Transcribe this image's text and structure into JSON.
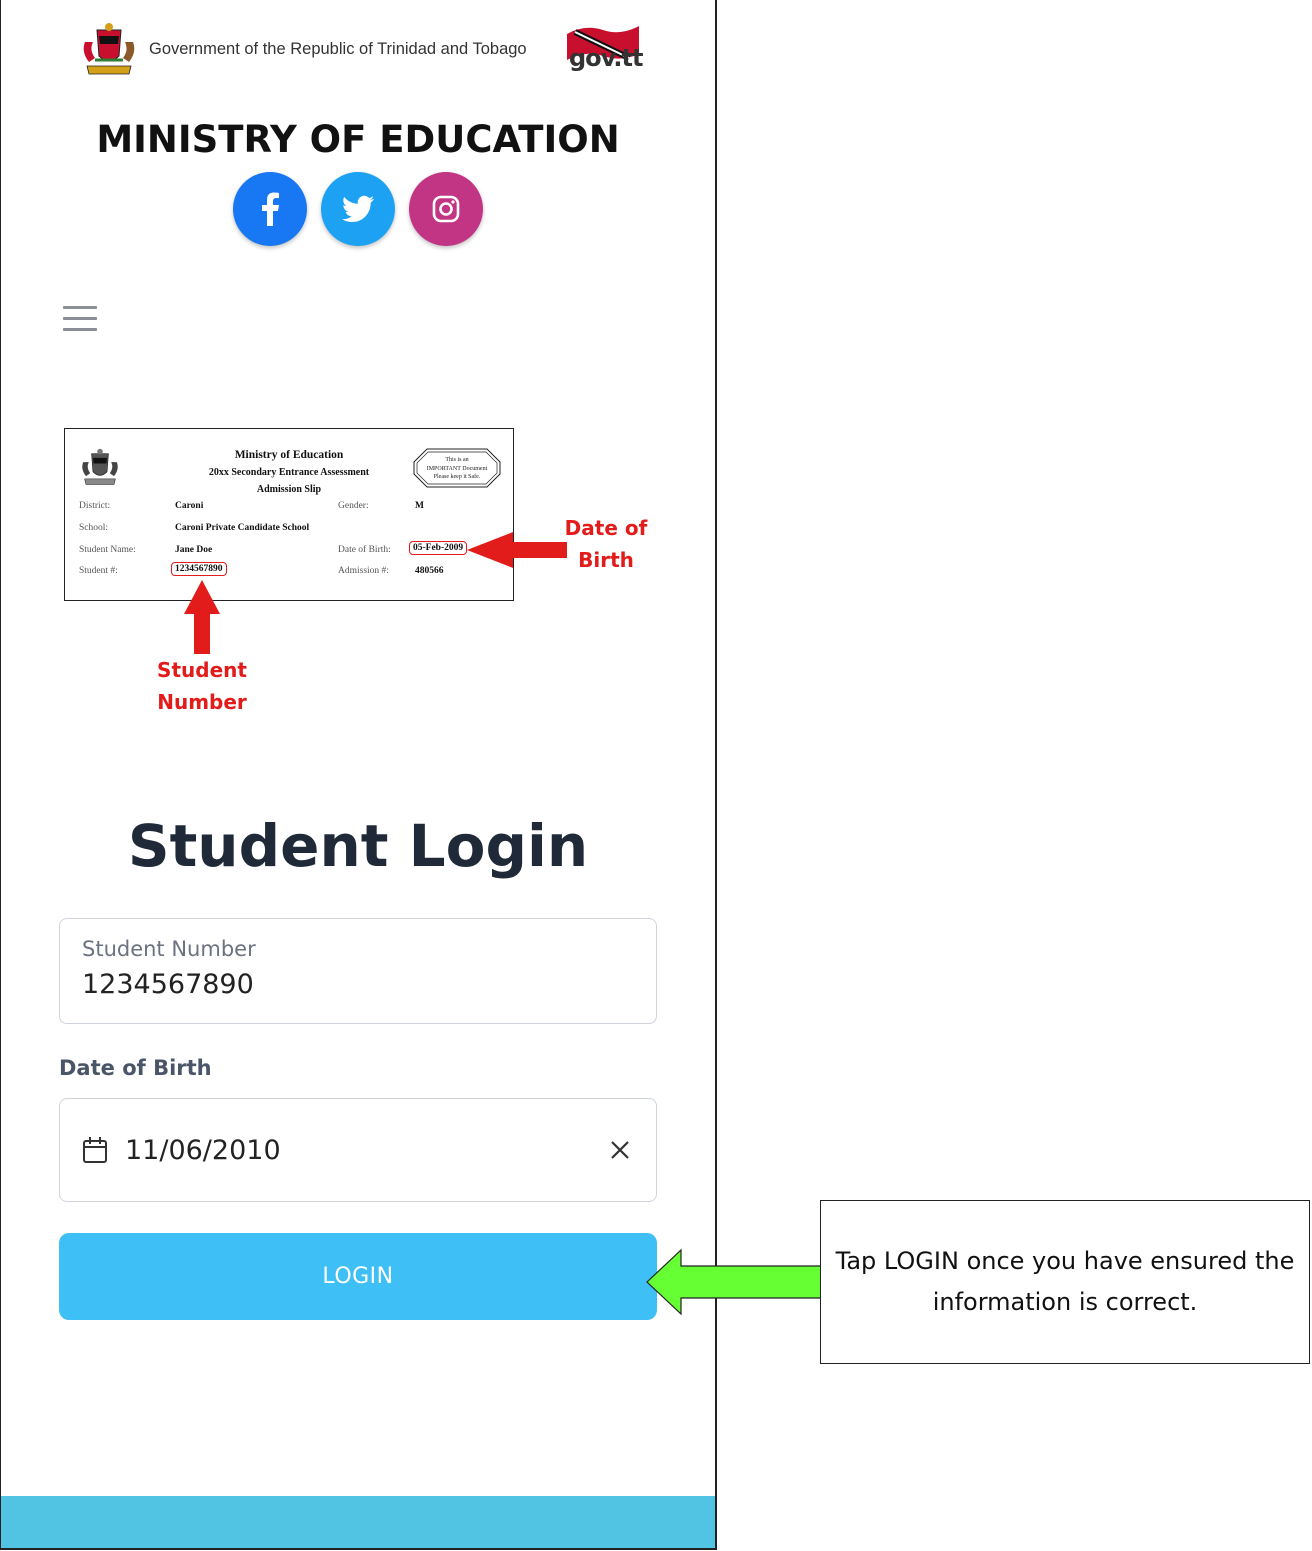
{
  "header": {
    "gov_text": "Government of the Republic of Trinidad and Tobago",
    "gov_logo_text": "gov.tt",
    "ministry_title": "MINISTRY OF EDUCATION"
  },
  "social": [
    {
      "name": "facebook-icon",
      "glyph": "f",
      "color": "#1877f2"
    },
    {
      "name": "twitter-icon",
      "color": "#1da1f2"
    },
    {
      "name": "instagram-icon",
      "color": "#c13584"
    }
  ],
  "slip": {
    "title1": "Ministry of Education",
    "title2": "20xx Secondary Entrance Assessment",
    "title3": "Admission Slip",
    "stamp_line1": "This is an",
    "stamp_line2": "IMPORTANT Document",
    "stamp_line3": "Please keep it Safe.",
    "district_label": "District:",
    "district_value": "Caroni",
    "gender_label": "Gender:",
    "gender_value": "M",
    "school_label": "School:",
    "school_value": "Caroni Private Candidate School",
    "student_name_label": "Student Name:",
    "student_name_value": "Jane Doe",
    "dob_label": "Date of Birth:",
    "dob_value": "05-Feb-2009",
    "student_no_label": "Student #:",
    "student_no_value": "1234567890",
    "admission_label": "Admission #:",
    "admission_value": "480566"
  },
  "annotations": {
    "dob_line1": "Date of",
    "dob_line2": "Birth",
    "student_line1": "Student",
    "student_line2": "Number",
    "callout": "Tap LOGIN once you have ensured the information is correct.",
    "red": "#e21b1b",
    "green": "#66ff33"
  },
  "form": {
    "title": "Student Login",
    "student_number_label": "Student Number",
    "student_number_value": "1234567890",
    "dob_label": "Date of Birth",
    "dob_value": "11/06/2010",
    "login_label": "LOGIN",
    "accent": "#3ebff5"
  }
}
